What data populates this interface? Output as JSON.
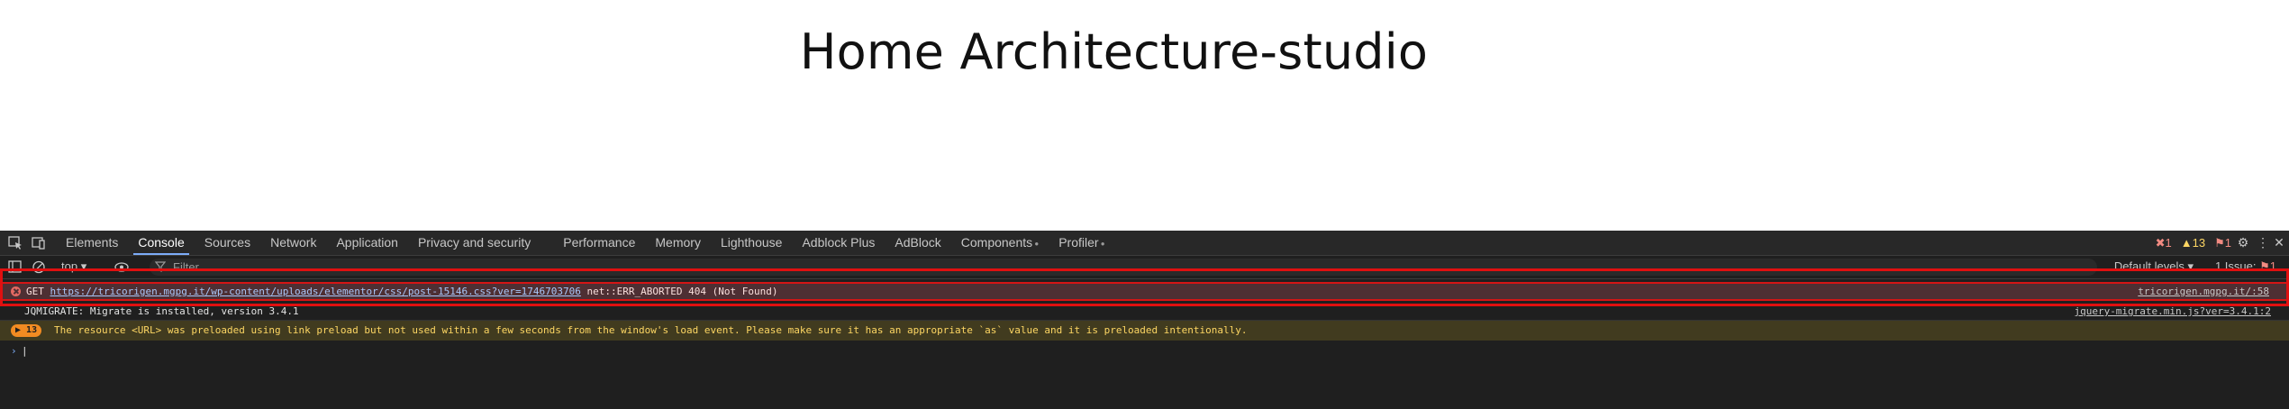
{
  "page": {
    "title": "Home Architecture-studio"
  },
  "devtools": {
    "tabs": [
      "Elements",
      "Console",
      "Sources",
      "Network",
      "Application",
      "Privacy and security",
      "Performance",
      "Memory",
      "Lighthouse",
      "Adblock Plus",
      "AdBlock",
      "Components",
      "Profiler"
    ],
    "active_tab": "Console",
    "status": {
      "errors": "1",
      "warnings": "13",
      "issues": "1"
    },
    "toolbar": {
      "context": "top",
      "filter_placeholder": "Filter",
      "levels": "Default levels",
      "issues_label": "1 Issue:",
      "issues_count": "1"
    },
    "messages": {
      "error": {
        "method": "GET",
        "url": "https://tricorigen.mgpg.it/wp-content/uploads/elementor/css/post-15146.css?ver=1746703706",
        "text": "net::ERR_ABORTED 404 (Not Found)",
        "source": "tricorigen.mgpg.it/:58"
      },
      "info": {
        "text": "JQMIGRATE: Migrate is installed, version 3.4.1",
        "source": "jquery-migrate.min.js?ver=3.4.1:2"
      },
      "warning": {
        "count": "13",
        "text": "The resource <URL> was preloaded using link preload but not used within a few seconds from the window's load event. Please make sure it has an appropriate `as` value and it is preloaded intentionally."
      }
    }
  },
  "colors": {
    "accent": "#7cacf8",
    "error": "#e46962",
    "warning": "#fdd663",
    "highlight": "#e01010"
  }
}
